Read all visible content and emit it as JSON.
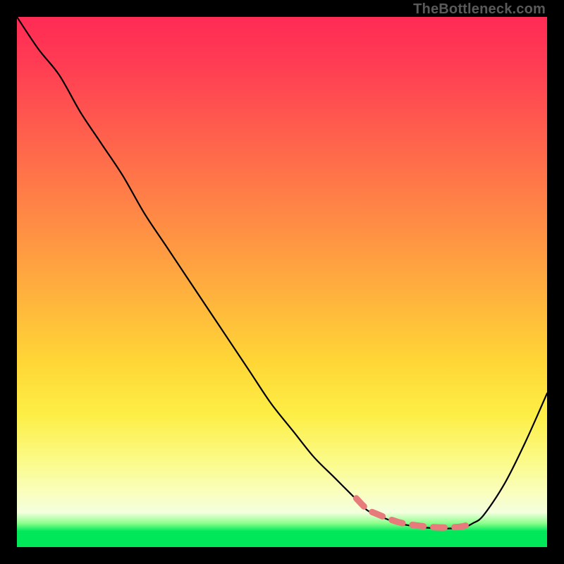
{
  "watermark": "TheBottleneck.com",
  "colors": {
    "gradient_top": "#ff2b55",
    "gradient_mid": "#ffd636",
    "gradient_bottom": "#00e85a",
    "curve": "#000000",
    "dashes": "#e77b7b",
    "frame": "#000000"
  },
  "chart_data": {
    "type": "line",
    "title": "",
    "xlabel": "",
    "ylabel": "",
    "xlim": [
      0,
      100
    ],
    "ylim": [
      0,
      100
    ],
    "note": "No axes, ticks, or labels are rendered in the image. X and Y values below are in percent of the plot area (0–100) read from the graphic; lower Y = lower on screen = closer to the green 'good' zone.",
    "series": [
      {
        "name": "bottleneck-curve",
        "x": [
          0,
          4,
          8,
          12,
          16,
          20,
          24,
          28,
          32,
          36,
          40,
          44,
          48,
          52,
          56,
          60,
          64,
          66,
          68,
          72,
          76,
          80,
          84,
          86,
          88,
          92,
          96,
          100
        ],
        "y": [
          100,
          94,
          89,
          82,
          76,
          70,
          63,
          57,
          51,
          45,
          39,
          33,
          27,
          22,
          17,
          13,
          9,
          7,
          6,
          4.5,
          3.8,
          3.5,
          3.7,
          4.5,
          6,
          12,
          20,
          29
        ]
      }
    ],
    "highlight_range": {
      "name": "optimal-zone-dashes",
      "x": [
        64,
        86
      ],
      "y_approx": 4
    }
  }
}
